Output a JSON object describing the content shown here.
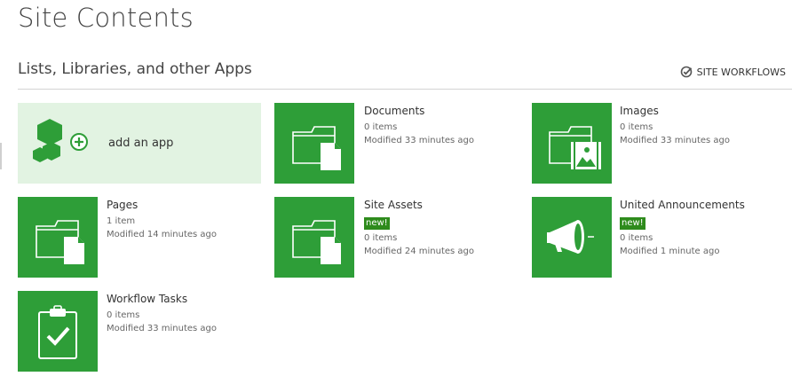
{
  "header": {
    "title": "Site Contents",
    "section_title": "Lists, Libraries, and other Apps",
    "workflows_label": "SITE WORKFLOWS"
  },
  "add_app": {
    "label": "add an app"
  },
  "apps": [
    {
      "name": "Documents",
      "new_badge": "",
      "count": "0 items",
      "modified": "Modified 33 minutes ago",
      "icon": "document-library-icon"
    },
    {
      "name": "Images",
      "new_badge": "",
      "count": "0 items",
      "modified": "Modified 33 minutes ago",
      "icon": "picture-library-icon"
    },
    {
      "name": "Pages",
      "new_badge": "",
      "count": "1 item",
      "modified": "Modified 14 minutes ago",
      "icon": "pages-library-icon"
    },
    {
      "name": "Site Assets",
      "new_badge": "new!",
      "count": "0 items",
      "modified": "Modified 24 minutes ago",
      "icon": "document-library-icon"
    },
    {
      "name": "United Announcements",
      "new_badge": "new!",
      "count": "0 items",
      "modified": "Modified 1 minute ago",
      "icon": "megaphone-icon"
    },
    {
      "name": "Workflow Tasks",
      "new_badge": "",
      "count": "0 items",
      "modified": "Modified 33 minutes ago",
      "icon": "task-list-icon"
    }
  ],
  "colors": {
    "tile_green": "#2e9e38",
    "add_app_background": "#e2f3e2",
    "new_badge_green": "#2e8b1c"
  }
}
